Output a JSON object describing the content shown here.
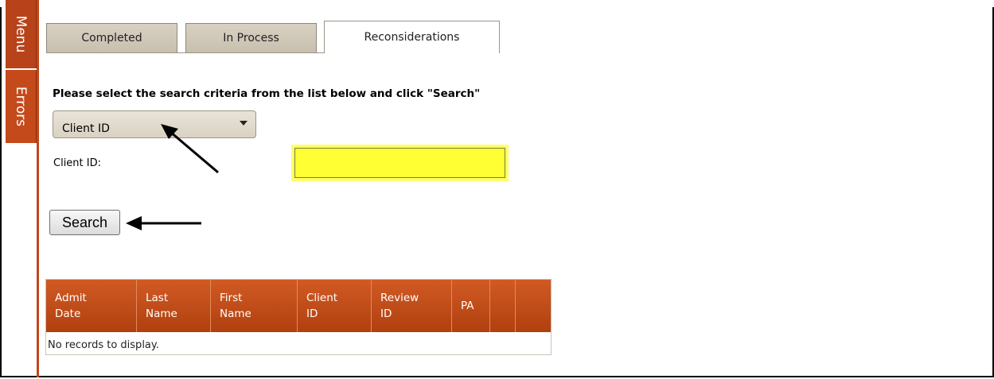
{
  "sidebar": {
    "menu_label": "Menu",
    "errors_label": "Errors"
  },
  "tabs": [
    {
      "label": "Completed",
      "active": false
    },
    {
      "label": "In Process",
      "active": false
    },
    {
      "label": "Reconsiderations",
      "active": true
    }
  ],
  "search": {
    "instructions": "Please select the search criteria from the list below and click \"Search\"",
    "criteria_selected": "Client ID",
    "field_label": "Client ID:",
    "field_value": "",
    "button_label": "Search"
  },
  "grid": {
    "columns": [
      "Admit Date",
      "Last Name",
      "First Name",
      "Client ID",
      "Review ID",
      "PA",
      "",
      ""
    ],
    "columns_display": [
      [
        "Admit",
        "Date"
      ],
      [
        "Last",
        "Name"
      ],
      [
        "First",
        "Name"
      ],
      [
        "Client",
        "ID"
      ],
      [
        "Review",
        "ID"
      ],
      [
        "PA",
        ""
      ],
      [
        "",
        ""
      ],
      [
        "",
        ""
      ]
    ],
    "empty_message": "No records to display."
  },
  "colors": {
    "accent": "#c2461a",
    "highlight": "#ffff33"
  }
}
